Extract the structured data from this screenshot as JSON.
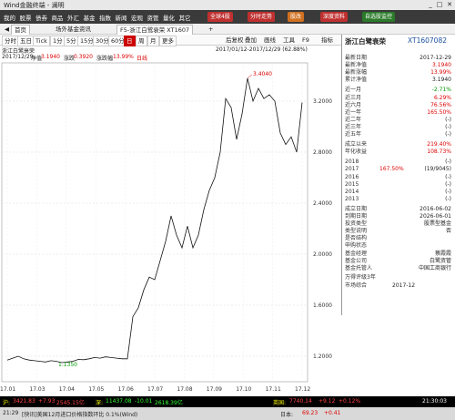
{
  "app": {
    "title": "Wind金融终端 - 澜明"
  },
  "menu": {
    "items": [
      "我的",
      "股票",
      "债券",
      "商品",
      "外汇",
      "基金",
      "指数",
      "新闻",
      "宏观",
      "资管",
      "量化",
      "其它"
    ],
    "pills": [
      {
        "label": "全球4股",
        "color": "#c03030"
      },
      {
        "label": "分时走势",
        "color": "#c03030"
      },
      {
        "label": "股改",
        "color": "#d07020"
      },
      {
        "label": "深度资料",
        "color": "#c03030"
      },
      {
        "label": "自选股监控",
        "color": "#2a7a2a"
      }
    ]
  },
  "tabs": [
    {
      "label": "首页"
    },
    {
      "label": "场外基金资讯"
    },
    {
      "label": "F5-浙江白鹭衰荣 XT1607"
    },
    {
      "label": "+"
    }
  ],
  "toolbar": {
    "periods": [
      "分时",
      "五日",
      "Tick",
      "1分",
      "5分",
      "15分",
      "30分",
      "60分",
      "日",
      "周",
      "月",
      "更多"
    ],
    "active_period": "日",
    "right_buttons": [
      "后复权",
      "叠加",
      "画线",
      "工具",
      "F9",
      "指标"
    ]
  },
  "chart_info": {
    "product_label": "浙江白鹭衰荣",
    "range_text": "2017/01/12-2017/12/29 (62.88%)",
    "date": "2017/12/29",
    "nav_label": "净值",
    "nav_value": "3.1940",
    "change_label": "涨跌",
    "change_value": "0.3920",
    "pct_label": "涨跌幅",
    "pct_value": "13.99%",
    "interval": "日线"
  },
  "chart_data": {
    "type": "line",
    "x": [
      "17.01",
      "17.03",
      "17.04",
      "17.05",
      "17.06",
      "17.07",
      "17.08",
      "17.09",
      "17.10",
      "17.11",
      "17.12"
    ],
    "series": [
      {
        "values": [
          1.17,
          1.185,
          1.2,
          1.18,
          1.17,
          1.165,
          1.16,
          1.155,
          1.165,
          1.16,
          1.15,
          1.155,
          1.16,
          1.175,
          1.173,
          1.18,
          1.19,
          1.185,
          1.195,
          1.19,
          1.185,
          1.18,
          1.18,
          1.51,
          1.58,
          1.72,
          1.82,
          1.8,
          1.95,
          2.1,
          2.3,
          2.15,
          2.05,
          2.22,
          2.05,
          2.15,
          2.35,
          2.5,
          2.6,
          2.8,
          3.22,
          3.15,
          2.9,
          3.1,
          3.38,
          3.2,
          3.3,
          3.22,
          3.25,
          3.2,
          2.95,
          2.86,
          2.92,
          2.8,
          3.19
        ]
      }
    ],
    "y_ticks": [
      "1.2000",
      "1.6000",
      "2.0000",
      "2.4000",
      "2.8000",
      "3.2000"
    ],
    "ylim": [
      1.0,
      3.5
    ],
    "max_label": "3.4040",
    "min_label": "1.1350"
  },
  "panel": {
    "title": "浙江白鹭衰荣",
    "code": "XT1607082",
    "rows": [
      {
        "label": "最新日期",
        "value": "2017-12-29",
        "cls": ""
      },
      {
        "label": "最新净值",
        "value": "3.1940",
        "cls": "red"
      },
      {
        "label": "最新涨幅",
        "value": "13.99%",
        "cls": "red"
      },
      {
        "label": "累计净值",
        "value": "3.1940",
        "cls": ""
      },
      {
        "label": "近一月",
        "value": "-2.71%",
        "cls": "green"
      },
      {
        "label": "近三月",
        "value": "6.29%",
        "cls": "red"
      },
      {
        "label": "近六月",
        "value": "76.56%",
        "cls": "red"
      },
      {
        "label": "近一年",
        "value": "165.50%",
        "cls": "red"
      },
      {
        "label": "近二年",
        "value": "(-)",
        "cls": ""
      },
      {
        "label": "近三年",
        "value": "(-)",
        "cls": ""
      },
      {
        "label": "近五年",
        "value": "(-)",
        "cls": ""
      },
      {
        "label": "成立以来",
        "value": "219.40%",
        "cls": "red"
      },
      {
        "label": "年化收益",
        "value": "108.73%",
        "cls": "red"
      }
    ],
    "yearly": [
      {
        "year": "2018",
        "v1": "",
        "v2": "(-)"
      },
      {
        "year": "2017",
        "v1": "167.50%",
        "v2": "(19/9045)"
      },
      {
        "year": "2016",
        "v1": "",
        "v2": "(-)"
      },
      {
        "year": "2015",
        "v1": "",
        "v2": "(-)"
      },
      {
        "year": "2014",
        "v1": "",
        "v2": "(-)"
      },
      {
        "year": "2013",
        "v1": "",
        "v2": "(-)"
      }
    ],
    "details": [
      {
        "label": "成立日期",
        "value": "2016-06-02"
      },
      {
        "label": "到期日期",
        "value": "2026-06-01"
      },
      {
        "label": "投资类型",
        "value": "股票型基金"
      },
      {
        "label": "类型说明",
        "value": "否"
      },
      {
        "label": "是否结构",
        "value": ""
      },
      {
        "label": "申购状态",
        "value": ""
      },
      {
        "label": "基金经理",
        "value": "蔡霞霞"
      },
      {
        "label": "基金公司",
        "value": "白鹭资管"
      },
      {
        "label": "基金托管人",
        "value": "中国工商银行"
      }
    ],
    "rating_label": "万得评级3年",
    "market_label": "市场综合",
    "market_value": "2017-12"
  },
  "status": {
    "sh_label": "沪:",
    "sh_val": "3421.83",
    "sh_chg": "+7.93",
    "sh_amt": "2545.15亿",
    "sz_label": "深:",
    "sz_val": "11437.08",
    "sz_chg": "-10.01",
    "sz_amt": "2618.39亿",
    "hk_label": "英国:",
    "hk_val": "7740.14",
    "hk_chg": "+9.12",
    "hk_pct": "+0.12%",
    "time": "21:30:03"
  },
  "news": {
    "time": "21:29",
    "text": "[快讯]美国12月进口价格指数环比 0.1%(Wind)",
    "index_label": "日本:",
    "index_val": "69.23",
    "index_chg": "+0.41"
  }
}
